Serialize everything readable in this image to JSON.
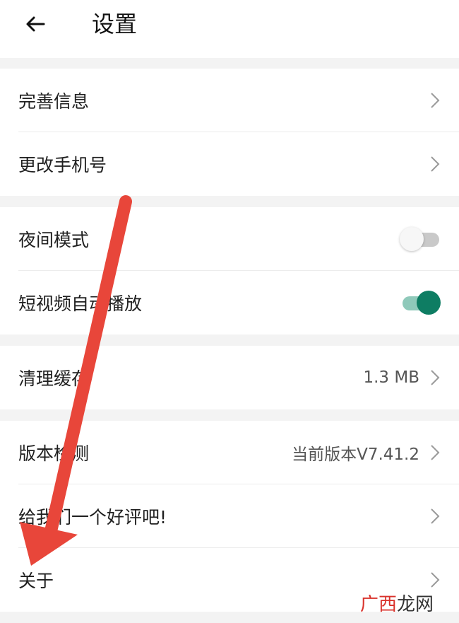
{
  "header": {
    "title": "设置"
  },
  "groups": [
    {
      "rows": [
        {
          "label": "完善信息"
        },
        {
          "label": "更改手机号"
        }
      ]
    },
    {
      "rows": [
        {
          "label": "夜间模式",
          "toggle": "off"
        },
        {
          "label": "短视频自动播放",
          "toggle": "on"
        }
      ]
    },
    {
      "rows": [
        {
          "label": "清理缓存",
          "value": "1.3 MB"
        }
      ]
    },
    {
      "rows": [
        {
          "label": "版本检测",
          "value": "当前版本V7.41.2"
        },
        {
          "label": "给我们一个好评吧!"
        },
        {
          "label": "关于"
        }
      ]
    }
  ],
  "watermark": {
    "part1": "广西",
    "part2": "龙网"
  },
  "colors": {
    "toggle_on": "#0e7d63",
    "arrow": "#e8463a"
  }
}
